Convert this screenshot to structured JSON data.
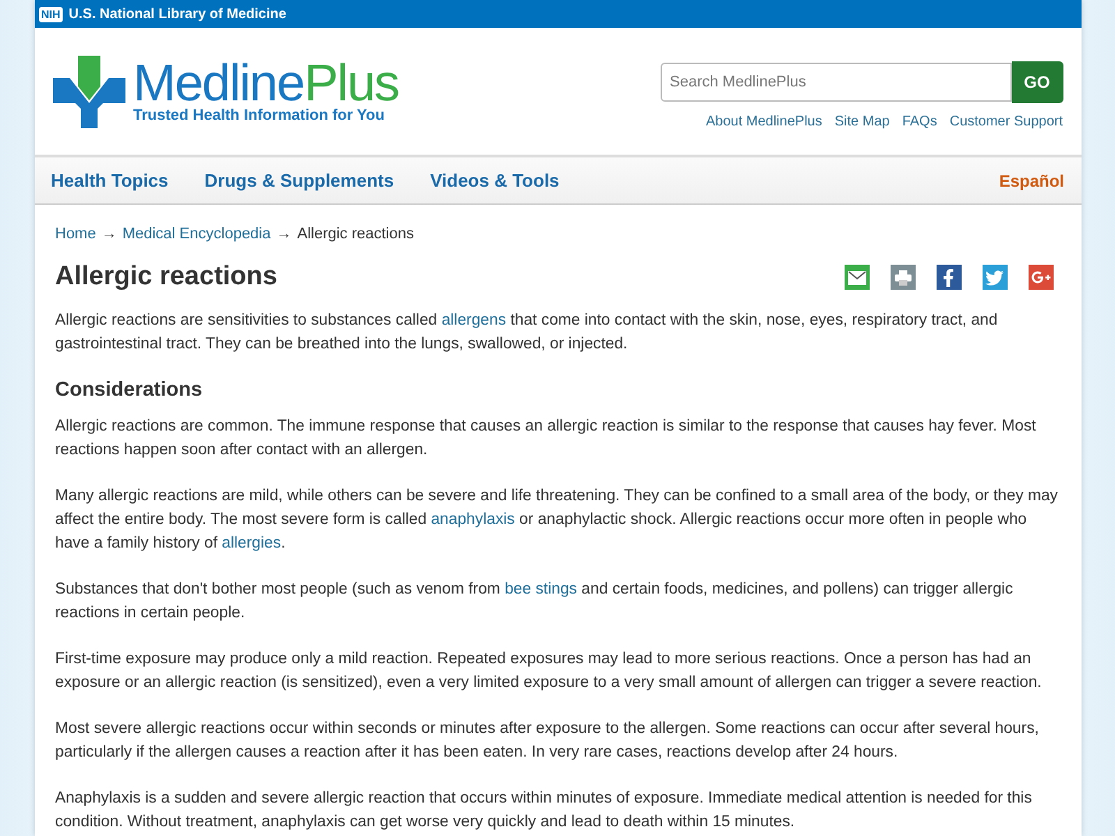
{
  "top_bar": {
    "badge": "NIH",
    "title": "U.S. National Library of Medicine"
  },
  "logo": {
    "name_part_1": "Medline",
    "name_part_2": "Plus",
    "tagline": "Trusted Health Information for You"
  },
  "search": {
    "placeholder": "Search MedlinePlus",
    "button": "GO"
  },
  "utility_links": [
    "About MedlinePlus",
    "Site Map",
    "FAQs",
    "Customer Support"
  ],
  "nav": {
    "items": [
      "Health Topics",
      "Drugs & Supplements",
      "Videos & Tools"
    ],
    "language": "Español"
  },
  "breadcrumb": [
    {
      "text": "Home",
      "kind": "link"
    },
    {
      "text": "→",
      "kind": "sep"
    },
    {
      "text": "Medical Encyclopedia",
      "kind": "link"
    },
    {
      "text": "→",
      "kind": "sep"
    },
    {
      "text": "Allergic reactions",
      "kind": "text"
    }
  ],
  "title": "Allergic reactions",
  "share": [
    {
      "kind": "email"
    },
    {
      "kind": "print"
    },
    {
      "kind": "facebook"
    },
    {
      "kind": "twitter"
    },
    {
      "kind": "google"
    }
  ],
  "blocks": [
    {
      "kind": "para",
      "parts": [
        {
          "kind": "text",
          "text": "Allergic reactions are sensitivities to substances called "
        },
        {
          "kind": "link",
          "text": "allergens"
        },
        {
          "kind": "text",
          "text": " that come into contact with the skin, nose, eyes, respiratory tract, and gastrointestinal tract. They can be breathed into the lungs, swallowed, or injected."
        }
      ]
    },
    {
      "kind": "heading",
      "text": "Considerations"
    },
    {
      "kind": "para",
      "parts": [
        {
          "kind": "text",
          "text": "Allergic reactions are common. The immune response that causes an allergic reaction is similar to the response that causes hay fever. Most reactions happen soon after contact with an allergen."
        }
      ]
    },
    {
      "kind": "para",
      "parts": [
        {
          "kind": "text",
          "text": "Many allergic reactions are mild, while others can be severe and life threatening. They can be confined to a small area of the body, or they may affect the entire body. The most severe form is called "
        },
        {
          "kind": "link",
          "text": "anaphylaxis"
        },
        {
          "kind": "text",
          "text": " or anaphylactic shock. Allergic reactions occur more often in people who have a family history of "
        },
        {
          "kind": "link",
          "text": "allergies"
        },
        {
          "kind": "text",
          "text": "."
        }
      ]
    },
    {
      "kind": "para",
      "parts": [
        {
          "kind": "text",
          "text": "Substances that don't bother most people (such as venom from "
        },
        {
          "kind": "link",
          "text": "bee stings"
        },
        {
          "kind": "text",
          "text": " and certain foods, medicines, and pollens) can trigger allergic reactions in certain people."
        }
      ]
    },
    {
      "kind": "para",
      "parts": [
        {
          "kind": "text",
          "text": "First-time exposure may produce only a mild reaction. Repeated exposures may lead to more serious reactions. Once a person has had an exposure or an allergic reaction (is sensitized), even a very limited exposure to a very small amount of allergen can trigger a severe reaction."
        }
      ]
    },
    {
      "kind": "para",
      "parts": [
        {
          "kind": "text",
          "text": "Most severe allergic reactions occur within seconds or minutes after exposure to the allergen. Some reactions can occur after several hours, particularly if the allergen causes a reaction after it has been eaten. In very rare cases, reactions develop after 24 hours."
        }
      ]
    },
    {
      "kind": "para",
      "parts": [
        {
          "kind": "text",
          "text": "Anaphylaxis is a sudden and severe allergic reaction that occurs within minutes of exposure. Immediate medical attention is needed for this condition. Without treatment, anaphylaxis can get worse very quickly and lead to death within 15 minutes."
        }
      ]
    }
  ]
}
